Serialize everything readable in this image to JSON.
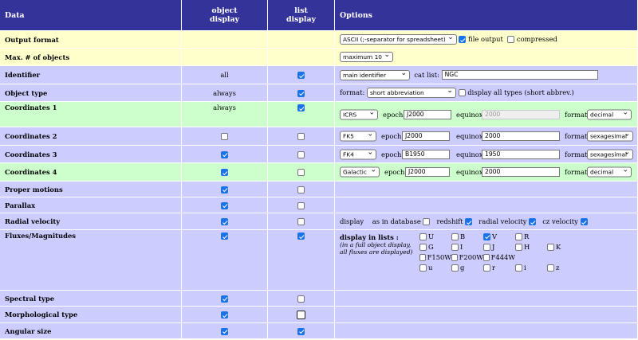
{
  "header": {
    "data": "Data",
    "object_display": "object\ndisplay",
    "object_display_l1": "object",
    "object_display_l2": "display",
    "list_display_l1": "list",
    "list_display_l2": "display",
    "options": "Options"
  },
  "rows": {
    "output_format": {
      "label": "Output format",
      "format_select": "ASCII (;-separator for spreadsheet)",
      "file_output_label": "file output",
      "file_output_checked": true,
      "compressed_label": "compressed",
      "compressed_checked": false
    },
    "max_objects": {
      "label": "Max. # of objects",
      "select": "maximum 10"
    },
    "identifier": {
      "label": "Identifier",
      "object": "all",
      "list_checked": true,
      "select": "main identifier",
      "cat_list_label": "cat list:",
      "cat_list_value": "NGC"
    },
    "object_type": {
      "label": "Object type",
      "object": "always",
      "list_checked": true,
      "format_label": "format:",
      "format_select": "short abbreviation",
      "display_all_label": "display all types (short abbrev.)",
      "display_all_checked": false
    },
    "coord1": {
      "label": "Coordinates 1",
      "object": "always",
      "list_checked": true,
      "frame": "ICRS",
      "epoch_label": "epoch:",
      "epoch": "J2000",
      "equinox_label": "equinox:",
      "equinox": "2000",
      "format_label": "format:",
      "format": "decimal"
    },
    "coord2": {
      "label": "Coordinates 2",
      "object_checked": false,
      "list_checked": false,
      "frame": "FK5",
      "epoch_label": "epoch:",
      "epoch": "J2000",
      "equinox_label": "equinox:",
      "equinox": "2000",
      "format_label": "format:",
      "format": "sexagesimal"
    },
    "coord3": {
      "label": "Coordinates 3",
      "object_checked": true,
      "list_checked": false,
      "frame": "FK4",
      "epoch_label": "epoch:",
      "epoch": "B1950",
      "equinox_label": "equinox:",
      "equinox": "1950",
      "format_label": "format:",
      "format": "sexagesimal"
    },
    "coord4": {
      "label": "Coordinates 4",
      "object_checked": true,
      "list_checked": false,
      "frame": "Galactic",
      "epoch_label": "epoch:",
      "epoch": "J2000",
      "equinox_label": "equinox:",
      "equinox": "2000",
      "format_label": "format:",
      "format": "decimal"
    },
    "proper_motions": {
      "label": "Proper motions",
      "object_checked": true,
      "list_checked": false
    },
    "parallax": {
      "label": "Parallax",
      "object_checked": true,
      "list_checked": false
    },
    "radial_velocity": {
      "label": "Radial velocity",
      "object_checked": true,
      "list_checked": false,
      "display_label": "display",
      "as_in_db_label": "as in database",
      "as_in_db_checked": false,
      "redshift_label": "redshift",
      "redshift_checked": true,
      "radvel_label": "radial velocity",
      "radvel_checked": true,
      "cz_label": "cz velocity",
      "cz_checked": true
    },
    "fluxes": {
      "label": "Fluxes/Magnitudes",
      "object_checked": true,
      "list_checked": true,
      "display_in_lists": "display in lists :",
      "note1": "(in a full object display,",
      "note2": "all fluxes are displayed)",
      "bands": [
        {
          "name": "U",
          "checked": false
        },
        {
          "name": "B",
          "checked": false
        },
        {
          "name": "V",
          "checked": true
        },
        {
          "name": "R",
          "checked": false
        },
        {
          "name": "",
          "checked": false
        },
        {
          "name": "G",
          "checked": false
        },
        {
          "name": "I",
          "checked": false
        },
        {
          "name": "J",
          "checked": false
        },
        {
          "name": "H",
          "checked": false
        },
        {
          "name": "K",
          "checked": false
        },
        {
          "name": "F150W",
          "checked": false
        },
        {
          "name": "F200W",
          "checked": false
        },
        {
          "name": "F444W",
          "checked": false
        },
        {
          "name": "",
          "checked": false
        },
        {
          "name": "",
          "checked": false
        },
        {
          "name": "u",
          "checked": false
        },
        {
          "name": "g",
          "checked": false
        },
        {
          "name": "r",
          "checked": false
        },
        {
          "name": "i",
          "checked": false
        },
        {
          "name": "z",
          "checked": false
        }
      ]
    },
    "spectral_type": {
      "label": "Spectral type",
      "object_checked": true,
      "list_checked": false
    },
    "morphological_type": {
      "label": "Morphological type",
      "object_checked": true,
      "list_checked": false
    },
    "angular_size": {
      "label": "Angular size",
      "object_checked": true,
      "list_checked": true
    }
  }
}
